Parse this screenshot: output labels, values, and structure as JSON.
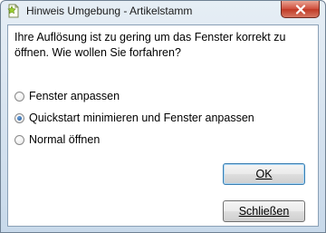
{
  "window": {
    "title": "Hinweis Umgebung - Artikelstamm",
    "app_icon": "document-star-icon",
    "close_icon": "close-icon"
  },
  "dialog": {
    "message_line1": "Ihre Auflösung ist zu gering um das Fenster korrekt zu",
    "message_line2": "öffnen. Wie wollen Sie forfahren?",
    "options": [
      {
        "label": "Fenster anpassen",
        "checked": false
      },
      {
        "label": "Quickstart minimieren und Fenster anpassen",
        "checked": true
      },
      {
        "label": "Normal öffnen",
        "checked": false
      }
    ],
    "ok_label": "OK",
    "close_label": "Schließen"
  },
  "colors": {
    "accent": "#1c4f8e",
    "close_button": "#c03a26",
    "frame": "#c8d9ea"
  }
}
